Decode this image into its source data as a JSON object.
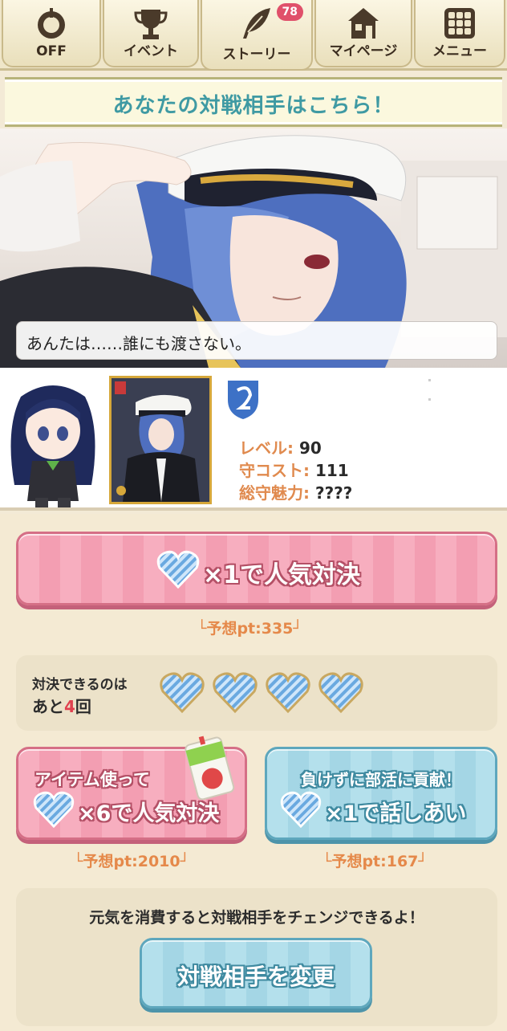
{
  "nav": {
    "items": [
      {
        "label": "OFF",
        "icon": "sound-off-icon"
      },
      {
        "label": "イベント",
        "icon": "trophy-icon"
      },
      {
        "label": "ストーリー",
        "icon": "feather-icon",
        "badge": "78"
      },
      {
        "label": "マイページ",
        "icon": "home-icon"
      },
      {
        "label": "メニュー",
        "icon": "grid-menu-icon"
      }
    ]
  },
  "banner": {
    "title": "あなたの対戦相手はこちら！"
  },
  "scene": {
    "dialog": "あんたは……誰にも渡さない。"
  },
  "profile": {
    "stats": [
      {
        "key": "レベル:",
        "value": "90"
      },
      {
        "key": "守コスト:",
        "value": "111"
      },
      {
        "key": "総守魅力:",
        "value": "????"
      }
    ]
  },
  "battle": {
    "main_button": "×1で人気対決",
    "main_predict": "予想pt:335",
    "remaining_line1": "対決できるのは",
    "remaining_prefix": "あと",
    "remaining_count": "4",
    "remaining_suffix": "回",
    "hearts_filled": 4,
    "item_button_top": "アイテム使って",
    "item_button_main": "×6で人気対決",
    "item_predict": "予想pt:2010",
    "talk_button_top": "負けずに部活に貢献！",
    "talk_button_main": "×1で話しあい",
    "talk_predict": "予想pt:167"
  },
  "change": {
    "message": "元気を消費すると対戦相手をチェンジできるよ！",
    "button": "対戦相手を変更"
  },
  "colors": {
    "accent_pink": "#f39eb2",
    "accent_blue": "#a4d6e5",
    "heart_blue": "#6aa9e0",
    "banner_text": "#3f9aa3",
    "stat_key": "#e08a4e"
  }
}
